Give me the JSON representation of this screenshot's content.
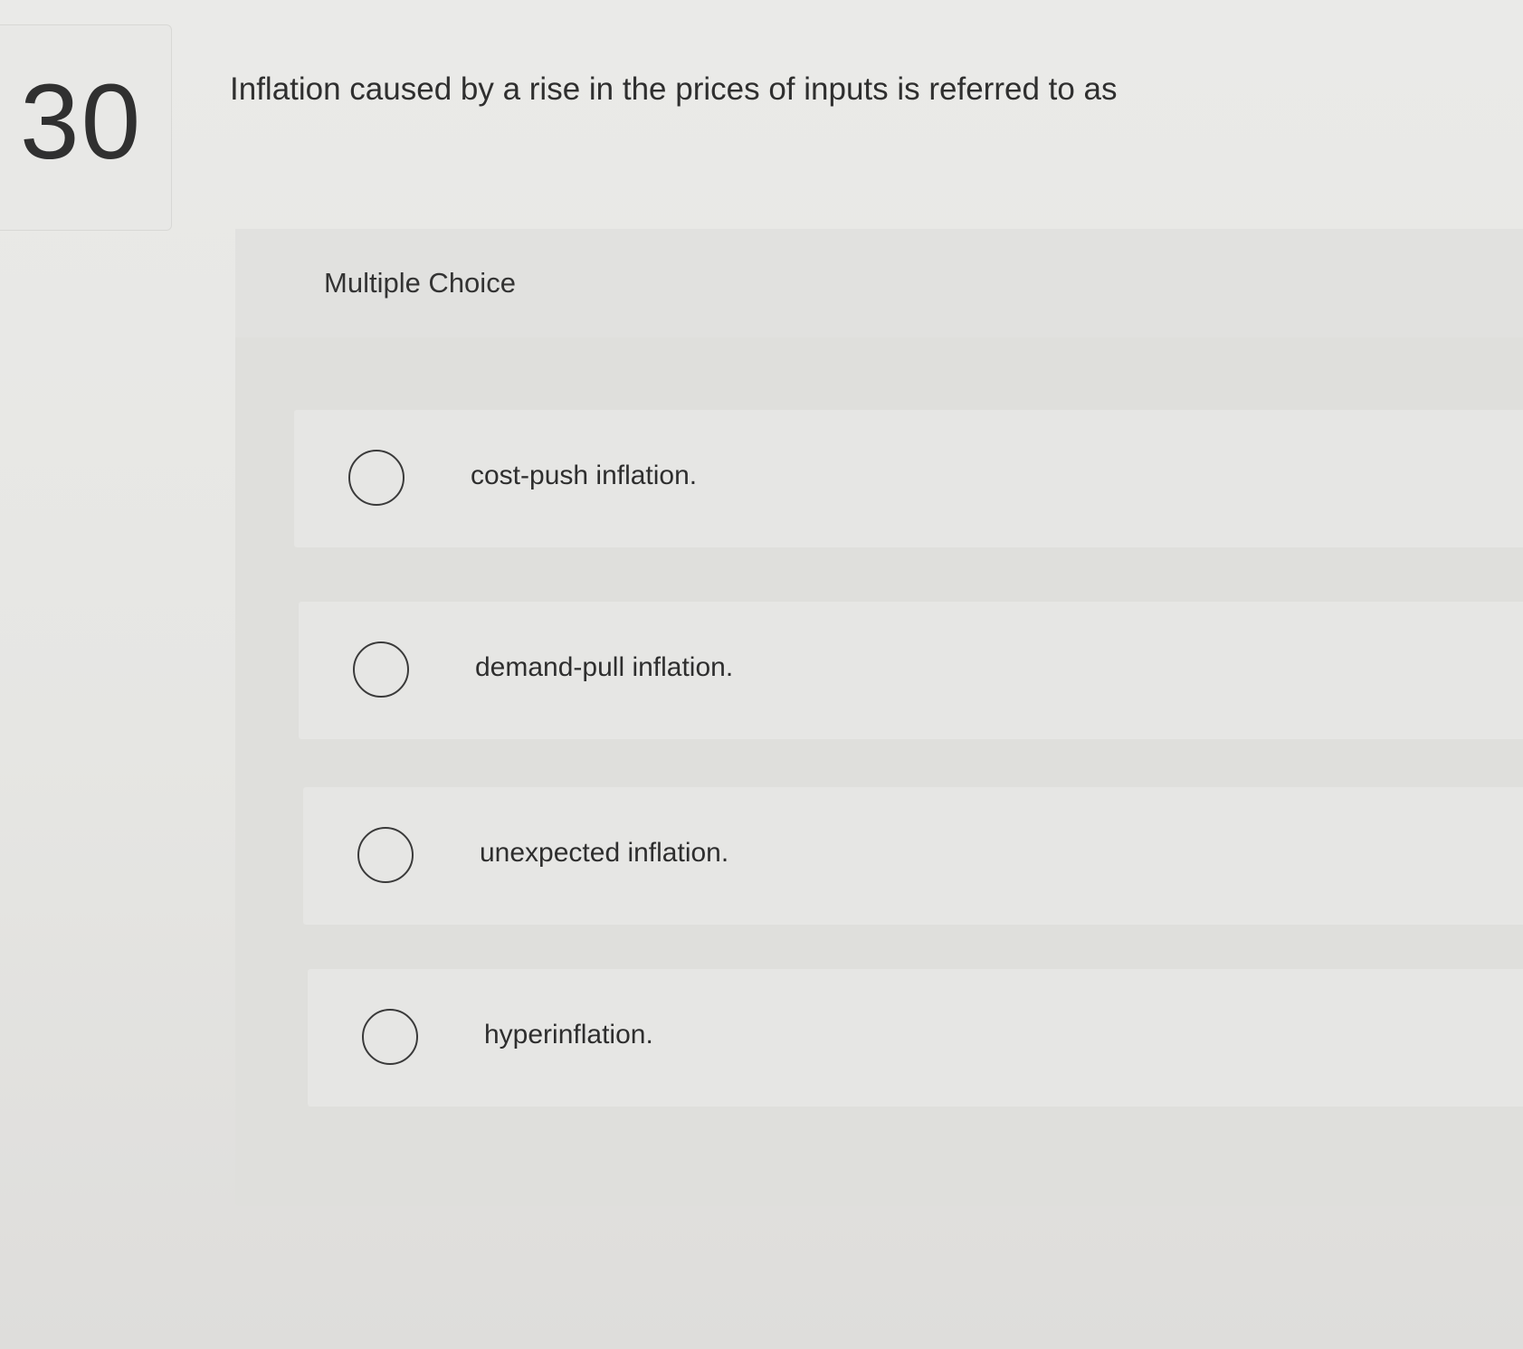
{
  "question": {
    "number": "30",
    "text": "Inflation caused by a rise in the prices of inputs is referred to as"
  },
  "choices": {
    "header": "Multiple Choice",
    "options": [
      {
        "label": "cost-push inflation.",
        "selected": false
      },
      {
        "label": "demand-pull inflation.",
        "selected": false
      },
      {
        "label": "unexpected inflation.",
        "selected": false
      },
      {
        "label": "hyperinflation.",
        "selected": false
      }
    ]
  }
}
